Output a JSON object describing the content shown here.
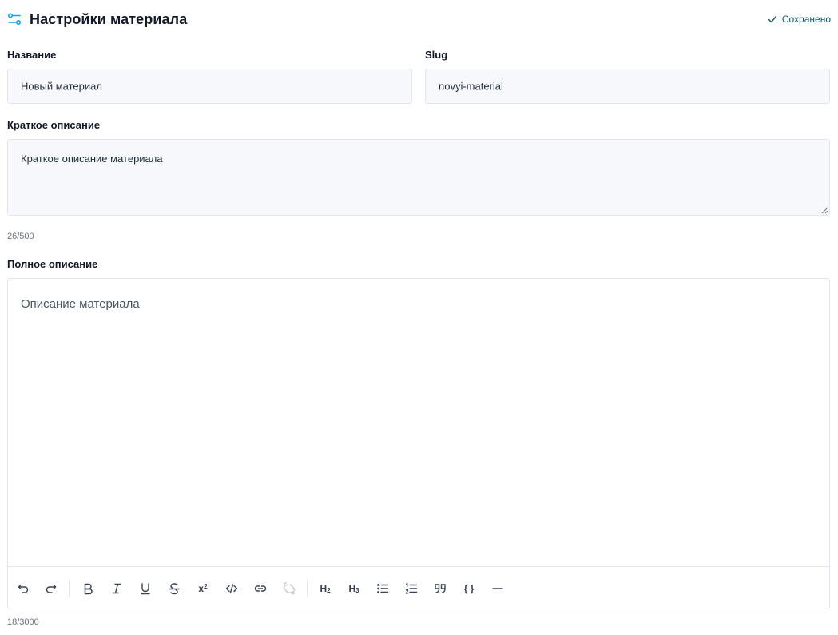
{
  "header": {
    "title": "Настройки материала",
    "status": "Сохранено",
    "accent_color": "#0ea5e9",
    "status_color": "#0f5b63",
    "icon": "sliders-icon"
  },
  "form": {
    "name_label": "Название",
    "name_value": "Новый материал",
    "slug_label": "Slug",
    "slug_value": "novyi-material",
    "short_desc_label": "Краткое описание",
    "short_desc_value": "Краткое описание материала",
    "short_desc_counter": "26/500",
    "full_desc_label": "Полное описание",
    "full_desc_placeholder": "Описание материала",
    "full_desc_counter": "18/3000"
  },
  "toolbar": {
    "buttons": [
      {
        "name": "undo-icon"
      },
      {
        "name": "redo-icon"
      },
      {
        "name": "bold-icon"
      },
      {
        "name": "italic-icon"
      },
      {
        "name": "underline-icon"
      },
      {
        "name": "strikethrough-icon"
      },
      {
        "name": "superscript-icon",
        "text": "x²"
      },
      {
        "name": "code-icon"
      },
      {
        "name": "link-icon"
      },
      {
        "name": "unlink-icon",
        "disabled": true
      },
      {
        "name": "heading2-icon",
        "text": "H2"
      },
      {
        "name": "heading3-icon",
        "text": "H3"
      },
      {
        "name": "bullet-list-icon"
      },
      {
        "name": "ordered-list-icon"
      },
      {
        "name": "blockquote-icon"
      },
      {
        "name": "code-block-icon",
        "text": "{ }"
      },
      {
        "name": "horizontal-rule-icon"
      }
    ]
  }
}
